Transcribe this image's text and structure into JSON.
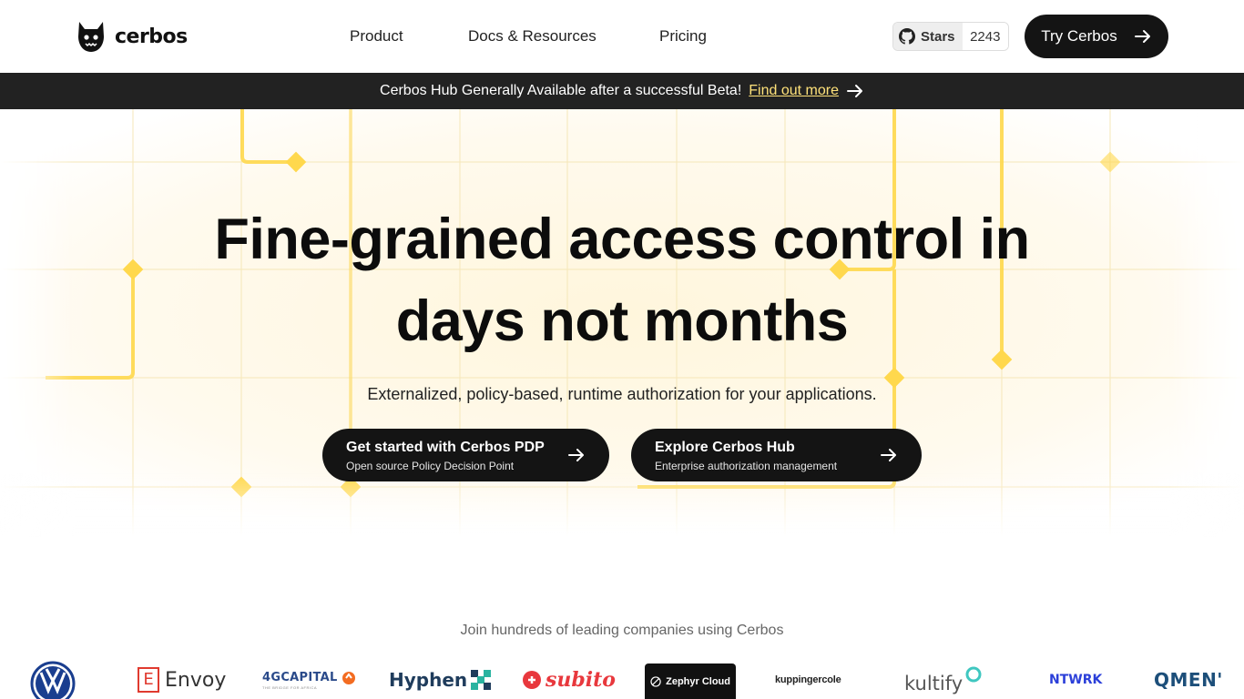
{
  "header": {
    "brand": "cerbos",
    "nav": [
      "Product",
      "Docs & Resources",
      "Pricing"
    ],
    "github": {
      "label": "Stars",
      "count": "2243"
    },
    "cta_label": "Try Cerbos"
  },
  "banner": {
    "text": "Cerbos Hub Generally Available after a successful Beta!",
    "link": "Find out more"
  },
  "hero": {
    "title_line1": "Fine-grained access control in",
    "title_line2": "days not months",
    "subtitle": "Externalized, policy-based, runtime authorization for your applications.",
    "cta_primary": {
      "title": "Get started with Cerbos PDP",
      "subtitle": "Open source Policy Decision Point"
    },
    "cta_secondary": {
      "title": "Explore Cerbos Hub",
      "subtitle": "Enterprise authorization management"
    }
  },
  "customers": {
    "title": "Join hundreds of leading companies using Cerbos",
    "logos": [
      "Volkswagen",
      "Envoy",
      "4GCAPITAL",
      "Hyphen",
      "subito",
      "Zephyr Cloud",
      "kuppingercole",
      "kultify",
      "NTWRK",
      "QMENT"
    ],
    "logo_text": {
      "envoy": "Envoy",
      "envoy_mark": "E",
      "fourg": "4GCAPITAL",
      "fourg_tag": "THE BRIDGE FOR AFRICA",
      "hyphen": "Hyphen",
      "subito": "subito",
      "zephyr": "Zephyr Cloud",
      "kupp": "kuppingercole",
      "kultify": "kultify",
      "ntwrk": "NTWRK",
      "qment": "QMEN'"
    }
  },
  "colors": {
    "dark": "#141414",
    "banner_bg": "#222222",
    "banner_link": "#ffe27a",
    "accent_yellow": "#ffd84d"
  },
  "icons": [
    "cerbos-logo-icon",
    "github-icon",
    "arrow-right-icon"
  ]
}
